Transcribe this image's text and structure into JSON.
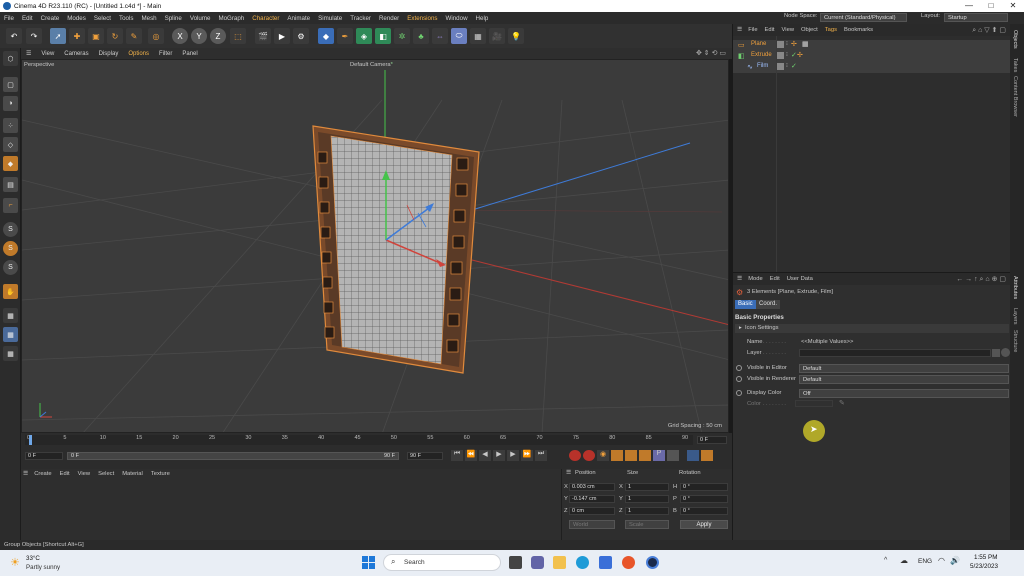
{
  "window": {
    "title": "Cinema 4D R23.110 (RC) - [Untitled 1.c4d *] - Main"
  },
  "menu": [
    "File",
    "Edit",
    "Create",
    "Modes",
    "Select",
    "Tools",
    "Mesh",
    "Spline",
    "Volume",
    "MoGraph",
    "Character",
    "Animate",
    "Simulate",
    "Tracker",
    "Render",
    "Extensions",
    "Window",
    "Help"
  ],
  "node_space": {
    "label": "Node Space:",
    "value": "Current (Standard/Physical)"
  },
  "layout": {
    "label": "Layout:",
    "value": "Startup"
  },
  "viewport": {
    "menu": [
      "View",
      "Cameras",
      "Display",
      "Options",
      "Filter",
      "Panel"
    ],
    "name": "Perspective",
    "camera": "Default Camera",
    "grid_spacing": "Grid Spacing : 50 cm"
  },
  "timeline": {
    "ticks": [
      "0",
      "5",
      "10",
      "15",
      "20",
      "25",
      "30",
      "35",
      "40",
      "45",
      "50",
      "55",
      "60",
      "65",
      "70",
      "75",
      "80",
      "85",
      "90"
    ],
    "current_frame": "0 F",
    "start": "0 F",
    "min": "0 F",
    "max": "90 F",
    "end": "90 F"
  },
  "material_manager": {
    "menu": [
      "Create",
      "Edit",
      "View",
      "Select",
      "Material",
      "Texture"
    ]
  },
  "coordinates": {
    "headers": [
      "Position",
      "Size",
      "Rotation"
    ],
    "rows": [
      {
        "axis": "X",
        "pos": "0.003 cm",
        "size_axis": "X",
        "size": "1",
        "rot_axis": "H",
        "rot": "0 °"
      },
      {
        "axis": "Y",
        "pos": "-0.147 cm",
        "size_axis": "Y",
        "size": "1",
        "rot_axis": "P",
        "rot": "0 °"
      },
      {
        "axis": "Z",
        "pos": "0 cm",
        "size_axis": "Z",
        "size": "1",
        "rot_axis": "B",
        "rot": "0 °"
      }
    ],
    "mode1": "World",
    "mode2": "Scale",
    "apply": "Apply"
  },
  "object_manager": {
    "menu": [
      "File",
      "Edit",
      "View",
      "Object",
      "Tags",
      "Bookmarks"
    ],
    "objects": [
      {
        "name": "Plane",
        "color": "#f0a03c",
        "indent": 0
      },
      {
        "name": "Extrude",
        "color": "#f0a03c",
        "indent": 0
      },
      {
        "name": "Film",
        "color": "#9fc0ff",
        "indent": 1
      }
    ]
  },
  "attributes": {
    "menu": [
      "Mode",
      "Edit",
      "User Data"
    ],
    "elements": "3 Elements [Plane, Extrude, Film]",
    "tabs": [
      "Basic",
      "Coord."
    ],
    "section": "Basic Properties",
    "group": "Icon Settings",
    "fields": [
      {
        "label": "Name",
        "value": "<<Multiple Values>>"
      },
      {
        "label": "Layer",
        "value": ""
      }
    ],
    "dropdowns": [
      {
        "label": "Visible in Editor",
        "value": "Default"
      },
      {
        "label": "Visible in Renderer",
        "value": "Default"
      },
      {
        "label": "Display Color",
        "value": "Off"
      }
    ],
    "color_label": "Color"
  },
  "right_tabs": [
    "Objects",
    "Takes",
    "Content Browser",
    "Attributes",
    "Layers",
    "Structure"
  ],
  "status": "Group Objects [Shortcut Alt+G]",
  "taskbar": {
    "weather_temp": "33°C",
    "weather_desc": "Partly sunny",
    "search": "Search",
    "lang": "ENG",
    "time": "1:55 PM",
    "date": "5/23/2023"
  },
  "colors": {
    "accent_orange": "#f0a03c",
    "axis_x": "#d0443c",
    "axis_y": "#45c34a",
    "axis_z": "#3e7bd8",
    "timeline_bg": "#2c2c2c"
  }
}
